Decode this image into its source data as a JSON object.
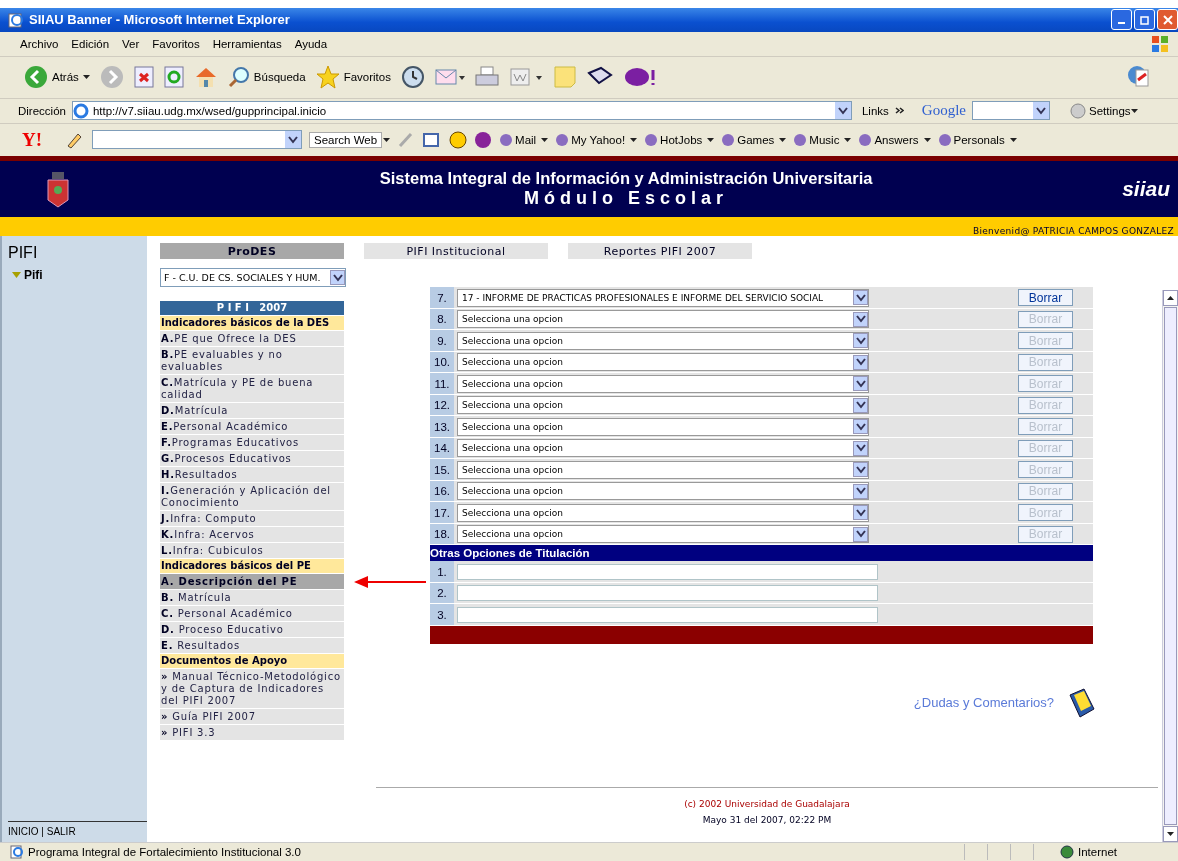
{
  "window": {
    "title": "SIIAU Banner - Microsoft Internet Explorer"
  },
  "menu_bar": [
    "Archivo",
    "Edición",
    "Ver",
    "Favoritos",
    "Herramientas",
    "Ayuda"
  ],
  "toolbar": {
    "back": "Atrás",
    "search": "Búsqueda",
    "favorites": "Favoritos"
  },
  "address_bar": {
    "label": "Dirección",
    "value": "http://v7.siiau.udg.mx/wsed/gupprincipal.inicio",
    "links": "Links",
    "google": "Google",
    "settings": "Settings"
  },
  "yahoo_toolbar": {
    "logo": "Y!",
    "search_button": "Search Web",
    "items": [
      "Mail",
      "My Yahoo!",
      "HotJobs",
      "Games",
      "Music",
      "Answers",
      "Personals"
    ]
  },
  "header": {
    "title": "Sistema Integral de Información y Administración Universitaria",
    "subtitle": "Módulo Escolar",
    "logo_text": "siiau",
    "welcome": "Bienvenid@  PATRICIA CAMPOS GONZALEZ"
  },
  "sidebar": {
    "title": "PIFI",
    "tree": [
      {
        "label": "Pifi",
        "expanded": true
      }
    ],
    "footer": "INICIO | SALIR"
  },
  "tabs": [
    {
      "label": "ProDES",
      "selected": true
    },
    {
      "label": "PIFI Institucional",
      "selected": false
    },
    {
      "label": "Reportes PIFI 2007",
      "selected": false
    }
  ],
  "prodes_select": {
    "value": "F - C.U. DE CS. SOCIALES Y HUM."
  },
  "menu": {
    "title": "P I F I   2007",
    "sections": [
      {
        "heading": "Indicadores básicos de la DES",
        "items": [
          {
            "key": "A.",
            "label": "PE que Ofrece la DES",
            "selected": false
          },
          {
            "key": "B.",
            "label": "PE evaluables y no evaluables",
            "selected": false
          },
          {
            "key": "C.",
            "label": "Matrícula y PE de buena calidad",
            "selected": false
          },
          {
            "key": "D.",
            "label": "Matrícula",
            "selected": false
          },
          {
            "key": "E.",
            "label": "Personal Académico",
            "selected": false
          },
          {
            "key": "F.",
            "label": "Programas Educativos",
            "selected": false
          },
          {
            "key": "G.",
            "label": "Procesos Educativos",
            "selected": false
          },
          {
            "key": "H.",
            "label": "Resultados",
            "selected": false
          },
          {
            "key": "I.",
            "label": "Generación y Aplicación del Conocimiento",
            "selected": false
          },
          {
            "key": "J.",
            "label": "Infra: Computo",
            "selected": false
          },
          {
            "key": "K.",
            "label": "Infra: Acervos",
            "selected": false
          },
          {
            "key": "L.",
            "label": "Infra: Cubiculos",
            "selected": false
          }
        ]
      },
      {
        "heading": "Indicadores básicos del PE",
        "items": [
          {
            "key": "A.",
            "label": " Descripción del PE",
            "selected": true
          },
          {
            "key": "B.",
            "label": " Matrícula",
            "selected": false
          },
          {
            "key": "C.",
            "label": " Personal Académico",
            "selected": false
          },
          {
            "key": "D.",
            "label": " Proceso Educativo",
            "selected": false
          },
          {
            "key": "E.",
            "label": " Resultados",
            "selected": false
          }
        ]
      },
      {
        "heading": "Documentos de Apoyo",
        "items": [
          {
            "key": "»",
            "label": " Manual Técnico-Metodológico y de Captura de Indicadores del PIFI 2007",
            "selected": false
          },
          {
            "key": "»",
            "label": " Guía PIFI 2007",
            "selected": false
          },
          {
            "key": "»",
            "label": " PIFI 3.3",
            "selected": false
          }
        ]
      }
    ]
  },
  "options": [
    {
      "number": "7.",
      "value": "17 - INFORME DE PRACTICAS PROFESIONALES E INFORME DEL SERVICIO SOCIAL",
      "button": "Borrar",
      "disabled": false
    },
    {
      "number": "8.",
      "value": "Selecciona una opcion",
      "button": "Borrar",
      "disabled": true
    },
    {
      "number": "9.",
      "value": "Selecciona una opcion",
      "button": "Borrar",
      "disabled": true
    },
    {
      "number": "10.",
      "value": "Selecciona una opcion",
      "button": "Borrar",
      "disabled": true
    },
    {
      "number": "11.",
      "value": "Selecciona una opcion",
      "button": "Borrar",
      "disabled": true
    },
    {
      "number": "12.",
      "value": "Selecciona una opcion",
      "button": "Borrar",
      "disabled": true
    },
    {
      "number": "13.",
      "value": "Selecciona una opcion",
      "button": "Borrar",
      "disabled": true
    },
    {
      "number": "14.",
      "value": "Selecciona una opcion",
      "button": "Borrar",
      "disabled": true
    },
    {
      "number": "15.",
      "value": "Selecciona una opcion",
      "button": "Borrar",
      "disabled": true
    },
    {
      "number": "16.",
      "value": "Selecciona una opcion",
      "button": "Borrar",
      "disabled": true
    },
    {
      "number": "17.",
      "value": "Selecciona una opcion",
      "button": "Borrar",
      "disabled": true
    },
    {
      "number": "18.",
      "value": "Selecciona una opcion",
      "button": "Borrar",
      "disabled": true
    }
  ],
  "other_options": {
    "heading": "Otras Opciones de Titulación",
    "rows": [
      {
        "number": "1."
      },
      {
        "number": "2."
      },
      {
        "number": "3."
      }
    ]
  },
  "help_link": "¿Dudas y Comentarios?",
  "footer": {
    "copyright": "(c) 2002 Universidad de Guadalajara",
    "date": "Mayo 31 del 2007, 02:22 PM"
  },
  "status_bar": {
    "text": "Programa Integral de Fortalecimiento Institucional 3.0",
    "zone": "Internet"
  }
}
